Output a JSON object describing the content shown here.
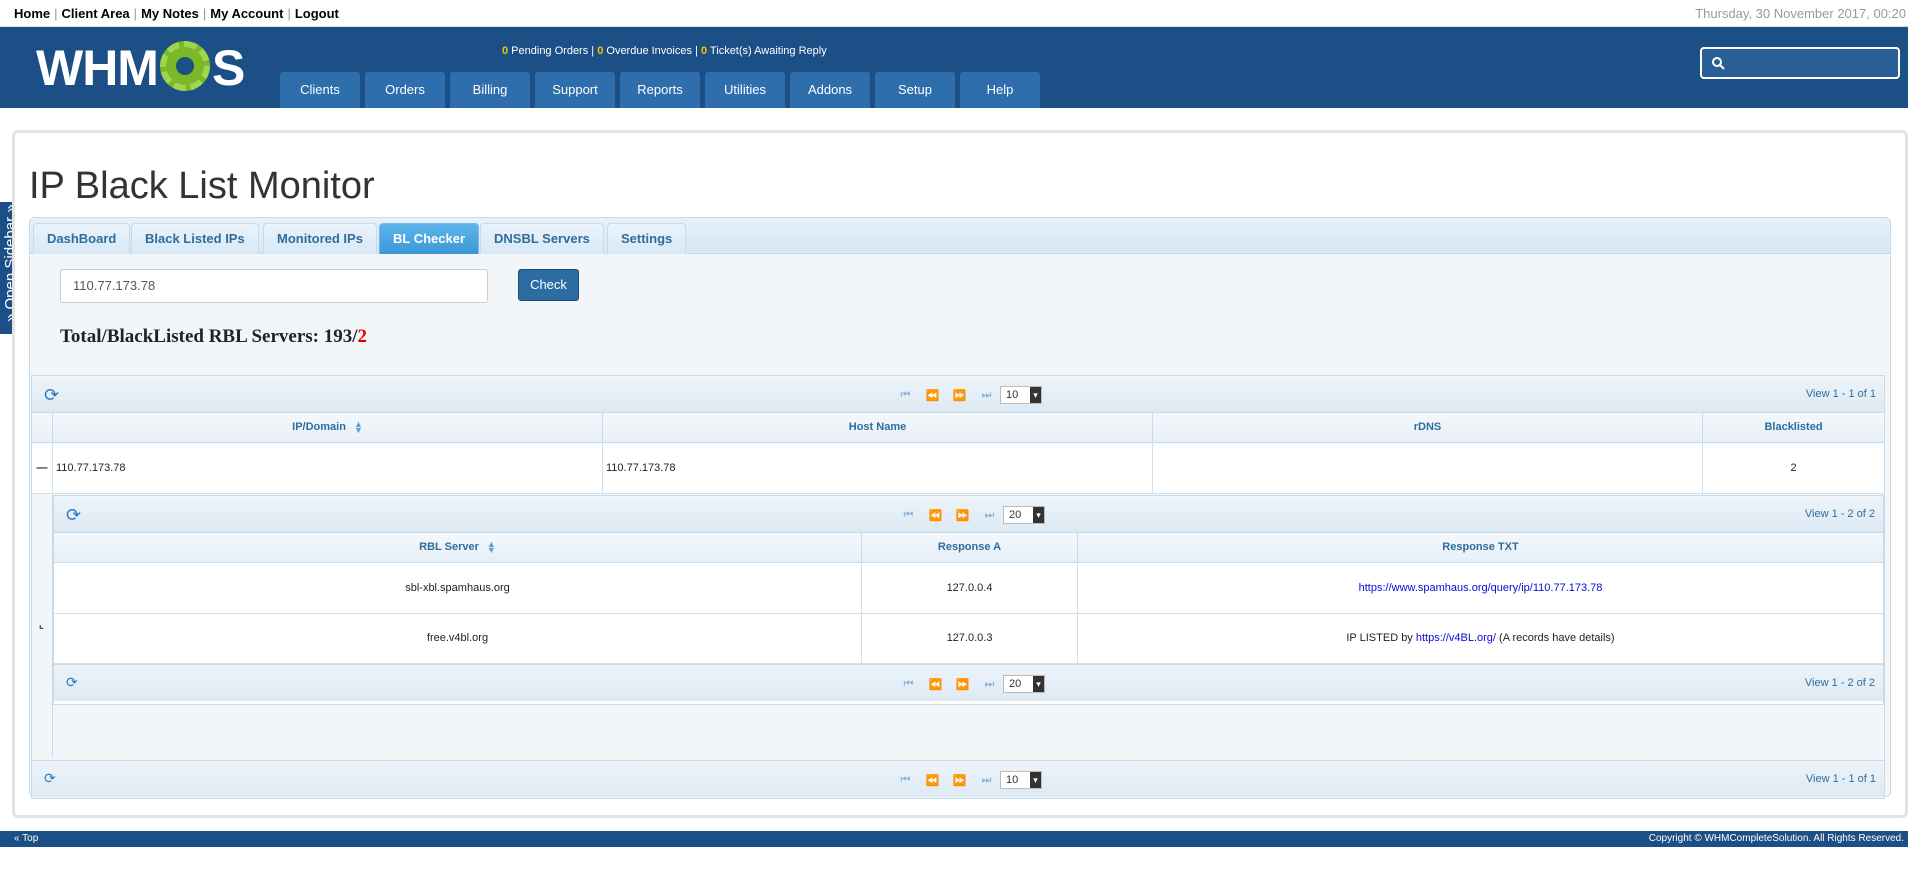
{
  "topbar": {
    "links": [
      "Home",
      "Client Area",
      "My Notes",
      "My Account",
      "Logout"
    ],
    "date": "Thursday, 30 November 2017, 00:20"
  },
  "header": {
    "logo_text_left": "WHM",
    "logo_text_right": "S",
    "stats": {
      "pending_count": "0",
      "pending_label": " Pending Orders | ",
      "overdue_count": "0",
      "overdue_label": " Overdue Invoices | ",
      "tickets_count": "0",
      "tickets_label": " Ticket(s) Awaiting Reply"
    },
    "nav": [
      "Clients",
      "Orders",
      "Billing",
      "Support",
      "Reports",
      "Utilities",
      "Addons",
      "Setup",
      "Help"
    ],
    "search_icon": "search-icon"
  },
  "sidebar_tab": "» Open Sidebar »",
  "page_title": "IP Black List Monitor",
  "tabs": [
    "DashBoard",
    "Black Listed IPs",
    "Monitored IPs",
    "BL Checker",
    "DNSBL Servers",
    "Settings"
  ],
  "active_tab": "BL Checker",
  "checker": {
    "ip_value": "110.77.173.78",
    "check_label": "Check",
    "summary_prefix": "Total/BlackListed RBL Servers: 193/",
    "summary_blacklisted": "2"
  },
  "outer_grid": {
    "page_size": "10",
    "view_info": "View 1 - 1 of 1",
    "columns": [
      "IP/Domain",
      "Host Name",
      "rDNS",
      "Blacklisted"
    ],
    "row": {
      "expand_symbol": "—",
      "ip": "110.77.173.78",
      "host": "110.77.173.78",
      "rdns": "",
      "blacklisted": "2"
    }
  },
  "sub_grid": {
    "page_size": "20",
    "view_info": "View 1 - 2 of 2",
    "columns": [
      "RBL Server",
      "Response A",
      "Response TXT"
    ],
    "rows": [
      {
        "server": "sbl-xbl.spamhaus.org",
        "response_a": "127.0.0.4",
        "txt_prefix": "",
        "txt_link": "https://www.spamhaus.org/query/ip/110.77.173.78",
        "txt_suffix": ""
      },
      {
        "server": "free.v4bl.org",
        "response_a": "127.0.0.3",
        "txt_prefix": "IP LISTED by ",
        "txt_link": "https://v4BL.org/",
        "txt_suffix": " (A records have details)"
      }
    ]
  },
  "footer": {
    "top_link": "« Top",
    "copyright": "Copyright © WHMCompleteSolution. All Rights Reserved."
  },
  "colors": {
    "header_blue": "#1b4f86",
    "accent_yellow": "#f5c400",
    "tab_active": "#3a97d6",
    "blacklist_red": "#e00000"
  }
}
